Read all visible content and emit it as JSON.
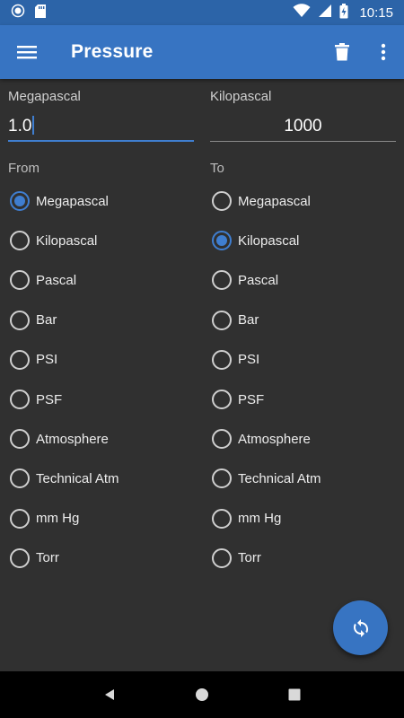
{
  "status_bar": {
    "time": "10:15",
    "icons": [
      "notification-dot-icon",
      "sd-card-icon",
      "wifi-icon",
      "signal-icon",
      "battery-charging-icon"
    ]
  },
  "app_bar": {
    "title": "Pressure",
    "menu_icon": "menu-icon",
    "delete_icon": "trash-icon",
    "more_icon": "more-vert-icon"
  },
  "from": {
    "unit_label": "Megapascal",
    "value": "1.0",
    "section_label": "From",
    "selected": "Megapascal",
    "options": [
      "Megapascal",
      "Kilopascal",
      "Pascal",
      "Bar",
      "PSI",
      "PSF",
      "Atmosphere",
      "Technical Atm",
      "mm Hg",
      "Torr"
    ]
  },
  "to": {
    "unit_label": "Kilopascal",
    "value": "1000",
    "section_label": "To",
    "selected": "Kilopascal",
    "options": [
      "Megapascal",
      "Kilopascal",
      "Pascal",
      "Bar",
      "PSI",
      "PSF",
      "Atmosphere",
      "Technical Atm",
      "mm Hg",
      "Torr"
    ]
  },
  "fab": {
    "icon": "swap-refresh-icon"
  },
  "nav_bar": {
    "icons": [
      "back-icon",
      "home-icon",
      "recents-icon"
    ]
  },
  "colors": {
    "primary": "#3774c2",
    "primary_dark": "#2c64a8",
    "accent": "#3f7ed0",
    "background": "#303030"
  }
}
